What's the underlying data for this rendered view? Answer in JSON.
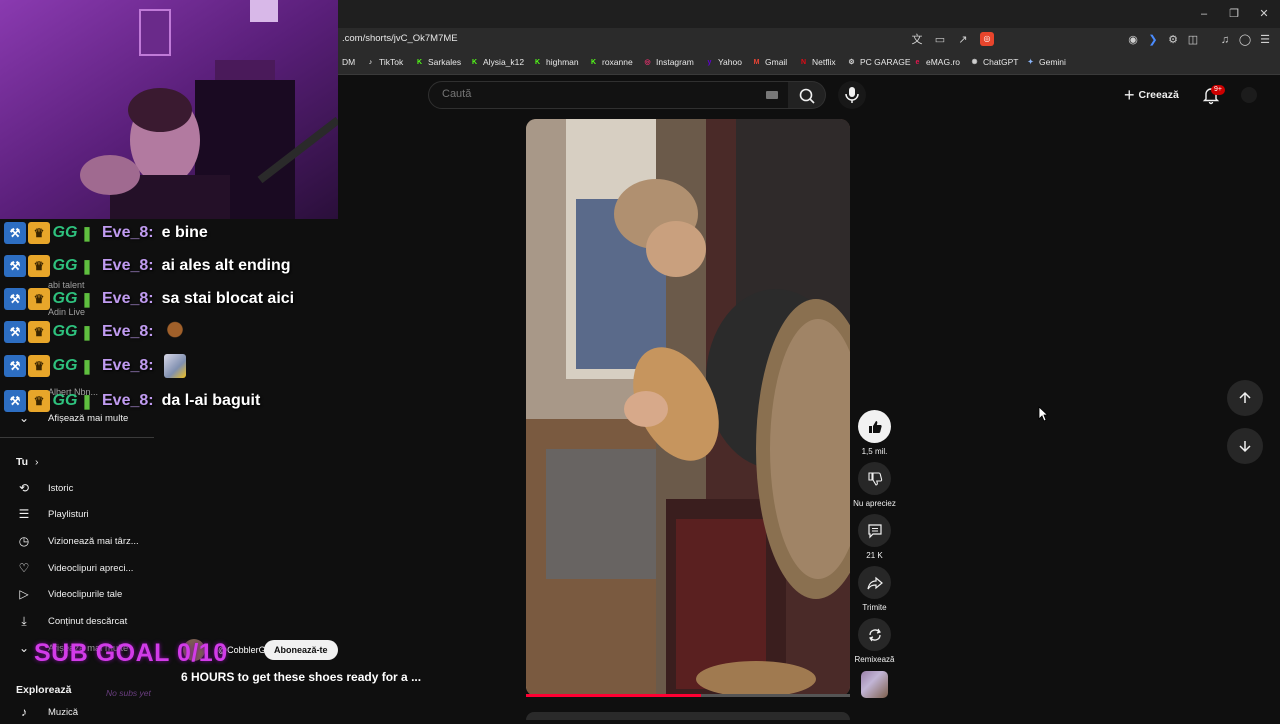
{
  "browser": {
    "url": ".com/shorts/jvC_Ok7M7ME",
    "bookmarks": [
      {
        "label": "DM",
        "icon": "dm-icon",
        "color": "#e8e8e8"
      },
      {
        "label": "TikTok",
        "icon": "tiktok-icon",
        "color": "#ffffff"
      },
      {
        "label": "Sarkales",
        "icon": "kick-icon",
        "color": "#53fc18"
      },
      {
        "label": "Alysia_k12",
        "icon": "kick-icon",
        "color": "#53fc18"
      },
      {
        "label": "highman",
        "icon": "kick-icon",
        "color": "#53fc18"
      },
      {
        "label": "roxanne",
        "icon": "kick-icon",
        "color": "#53fc18"
      },
      {
        "label": "Instagram",
        "icon": "instagram-icon",
        "color": "#e1306c"
      },
      {
        "label": "Yahoo",
        "icon": "yahoo-icon",
        "color": "#6001d2"
      },
      {
        "label": "Gmail",
        "icon": "gmail-icon",
        "color": "#ea4335"
      },
      {
        "label": "Netflix",
        "icon": "netflix-icon",
        "color": "#e50914"
      },
      {
        "label": "PC GARAGE",
        "icon": "pc-garage-icon",
        "color": "#cfcfcf"
      },
      {
        "label": "eMAG.ro",
        "icon": "emag-icon",
        "color": "#e3174f"
      },
      {
        "label": "ChatGPT",
        "icon": "chatgpt-icon",
        "color": "#cfcfcf"
      },
      {
        "label": "Gemini",
        "icon": "gemini-icon",
        "color": "#8ab4f8"
      }
    ]
  },
  "header": {
    "search_placeholder": "Caută",
    "create_label": "Creează",
    "notification_badge": "9+"
  },
  "short": {
    "title": "6 HOURS to get these shoes ready for a ...",
    "channel": "@CobblerG",
    "subscribe_label": "Abonează-te",
    "progress": 0.54,
    "actions": {
      "like_count": "1,5 mil.",
      "dislike_label": "Nu apreciez",
      "comments_count": "21 K",
      "share_label": "Trimite",
      "remix_label": "Remixează"
    }
  },
  "chat": [
    {
      "user": "Eve_8:",
      "message": "e bine",
      "emote": null
    },
    {
      "user": "Eve_8:",
      "message": "ai ales alt ending",
      "emote": null
    },
    {
      "user": "Eve_8:",
      "message": "sa stai blocat aici",
      "emote": null
    },
    {
      "user": "Eve_8:",
      "message": "",
      "emote": "monkey-emote"
    },
    {
      "user": "Eve_8:",
      "message": "",
      "emote": "face-emote"
    },
    {
      "user": "Eve_8:",
      "message": "da l-ai baguit",
      "emote": null
    }
  ],
  "chat_badge_text": "GG",
  "sidebar": {
    "ghost_items": [
      "abi talent",
      "Adin Live",
      "Albert Nbn..."
    ],
    "show_more": "Afișează mai multe",
    "you_section": "Tu",
    "you_items": [
      {
        "label": "Istoric",
        "icon": "history-icon"
      },
      {
        "label": "Playlisturi",
        "icon": "playlists-icon"
      },
      {
        "label": "Vizionează mai târz...",
        "icon": "watch-later-icon"
      },
      {
        "label": "Videoclipuri apreci...",
        "icon": "liked-videos-icon"
      },
      {
        "label": "Videoclipurile tale",
        "icon": "your-videos-icon"
      },
      {
        "label": "Conținut descărcat",
        "icon": "downloads-icon"
      }
    ],
    "show_more_2": "Afișează mai multe",
    "explore_section": "Explorează",
    "explore_items": [
      {
        "label": "Muzică",
        "icon": "music-icon"
      }
    ]
  },
  "overlay": {
    "sub_goal": "SUB GOAL 0/10",
    "sub_hint": "No subs yet"
  }
}
